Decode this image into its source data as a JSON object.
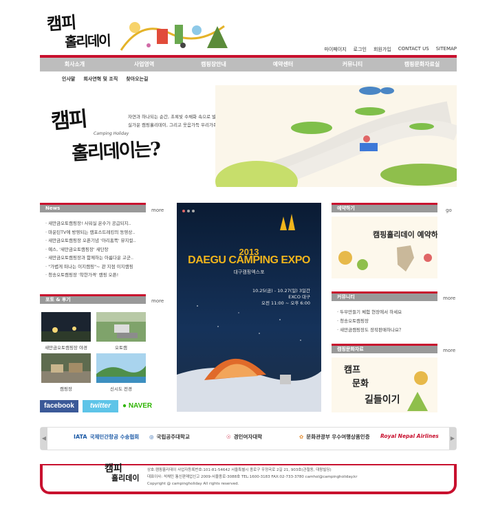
{
  "logo": {
    "line1": "캠피",
    "line2": "홀리데이"
  },
  "top_links": [
    "마이페이지",
    "로그인",
    "회원가입",
    "CONTACT US",
    "SITEMAP"
  ],
  "nav": [
    "회사소개",
    "사업영역",
    "캠핑장안내",
    "예약센터",
    "커뮤니티",
    "캠핑문화자료실"
  ],
  "subnav": [
    "인사말",
    "회사연혁 및 조직",
    "찾아오는길"
  ],
  "hero": {
    "title1": "캠피",
    "subtitle": "Camping Holiday",
    "title2": "홀리데이는?",
    "text_line1": "자연과 하나되는 순간, 초록빛 수채화 속으로 발을 내딛는 순간,",
    "text_line2": "실가운 캠핑홀리데이, 그리고 웃음가득 우리가족! 고맙고, 행복합니다."
  },
  "news": {
    "title": "News",
    "more": "more",
    "items": [
      "새만금오토캠핑장! 사워실 온수가 공급되지..",
      "마운틴TV에 방영되는 캠포스트레킹의 동영상..",
      "새만금오토캠핑장 오픈기념 '아리홈쪽' 뮤지컬..",
      "예스, '새만금오토캠핑장' 새단장",
      "새만금오토캠핑장과 함께하는 아름다운 고군..",
      "\"가볍게 떠나는 이지캠핑\"~ 관 지점 이지캠핑",
      "청송오토캠핑장 '착한가격' 캠핑 오픈!"
    ]
  },
  "photo": {
    "title": "포토 & 후기",
    "more": "more",
    "captions": [
      "새만금오토캠핑장 야경",
      "오토캠",
      "캠핑장",
      "신시도 전경"
    ]
  },
  "social": {
    "facebook": "facebook",
    "twitter": "twitter",
    "naver": "NAVER"
  },
  "poster": {
    "year": "2013",
    "title": "DAEGU CAMPING EXPO",
    "subtitle_kr": "대구캠핑엑스포",
    "date": "10.25(금) - 10.27(일) 3일간",
    "venue": "EXCO 대구",
    "hours": "오전 11:00 ~ 오후 6:00"
  },
  "reserve": {
    "title": "예약하기",
    "go": "go",
    "art_text": "캠핑홀리데이 예약하기"
  },
  "community": {
    "title": "커뮤니티",
    "more": "more",
    "items": [
      "두부만들기 체험 현장에서 하세요",
      "청송오토캠핑장",
      "새만금캠핑장도 장작판매하나요？"
    ]
  },
  "culture": {
    "title": "캠핑문화자료",
    "more": "more",
    "art_text1": "캠프",
    "art_text2": "문화",
    "art_text3": "길들이기"
  },
  "partners": [
    {
      "name": "국제민간항공 수송협회",
      "mark": "IATA"
    },
    {
      "name": "국립공주대학교",
      "mark": ""
    },
    {
      "name": "경인여자대학",
      "mark": ""
    },
    {
      "name": "문화관광부 우수여행상품인증",
      "mark": ""
    },
    {
      "name": "Royal Nepal Airlines",
      "mark": ""
    }
  ],
  "footer": {
    "logo1": "캠피",
    "logo2": "홀리데이",
    "line1": "상호:캠핑홀리데이    사업자등록번호:101-81-54642   서울특별시 종로구 우정국로 2길 21, 903호(관철동, 대왕빌딩)",
    "line2": "대표이사: 석채민    통신판매업신고 2009-서울종로-3088호     TEL:1600-3183     FAX:02-733-3780     camhol@campingholiday.kr",
    "line3": "Copyright @ campingholiday All rights reserved."
  },
  "colors": {
    "brand_red": "#c8102e",
    "nav_gray": "#bdbdbd",
    "box_gray": "#999999"
  }
}
